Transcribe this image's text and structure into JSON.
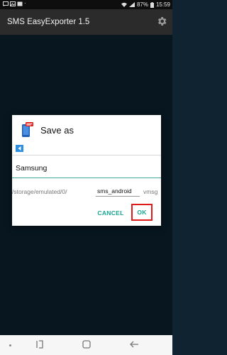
{
  "status_bar": {
    "battery": "87%",
    "time": "15:59"
  },
  "app_bar": {
    "title": "SMS EasyExporter 1.5",
    "settings_icon": "gear-icon"
  },
  "dialog": {
    "title": "Save as",
    "app_icon": "phone-sms-icon",
    "back_icon": "arrow-left-icon",
    "folder_name": "Samsung",
    "path_prefix": "/storage/emulated/0/",
    "file_name": "sms_android",
    "extension": "vmsg",
    "cancel_label": "CANCEL",
    "ok_label": "OK"
  },
  "nav_bar": {
    "icons": [
      "recent-apps-icon",
      "home-icon",
      "back-icon"
    ]
  },
  "colors": {
    "app_bar": "#2b2b2b",
    "content_bg": "#0c2330",
    "accent": "#17a592",
    "highlight": "#e01b1b"
  }
}
